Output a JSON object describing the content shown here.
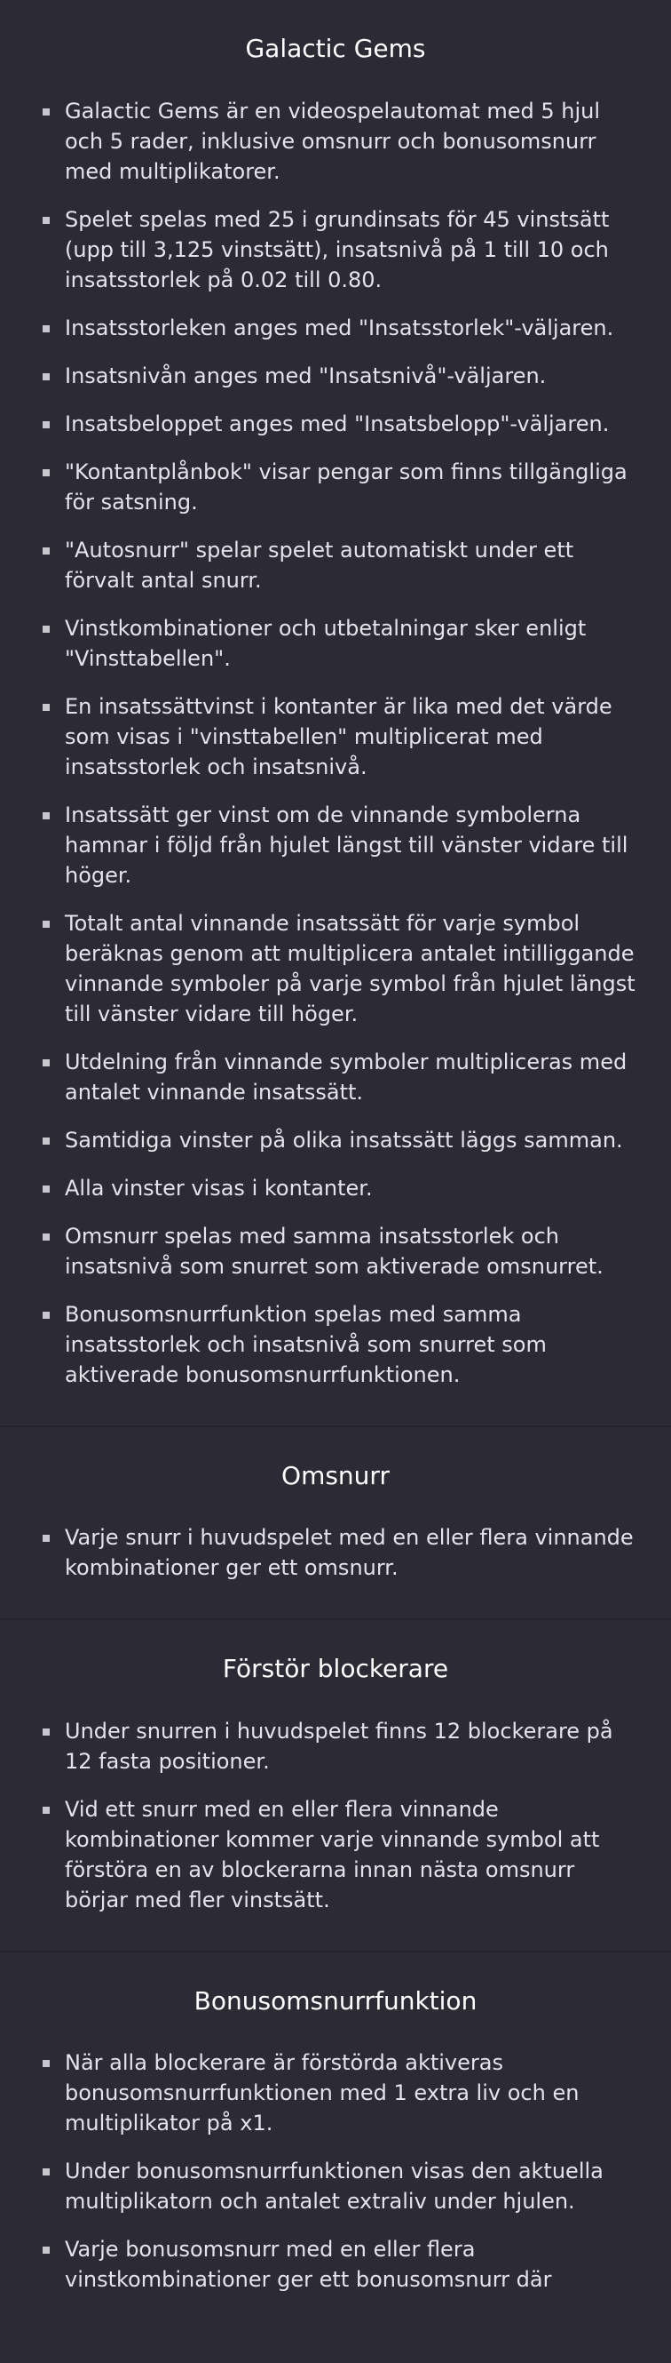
{
  "sections": [
    {
      "title": "Galactic Gems",
      "items": [
        "Galactic Gems är en videospelautomat med 5 hjul och 5 rader, inklusive omsnurr och bonusomsnurr med multiplikatorer.",
        "Spelet spelas med 25 i grundinsats för 45 vinstsätt (upp till 3,125 vinstsätt), insatsnivå på 1 till 10 och insatsstorlek på 0.02 till 0.80.",
        "Insatsstorleken anges med \"Insatsstorlek\"-väljaren.",
        "Insatsnivån anges med \"Insatsnivå\"-väljaren.",
        "Insatsbeloppet anges med \"Insatsbelopp\"-väljaren.",
        "\"Kontantplånbok\" visar pengar som finns tillgängliga för satsning.",
        "\"Autosnurr\" spelar spelet automatiskt under ett förvalt antal snurr.",
        "Vinstkombinationer och utbetalningar sker enligt \"Vinsttabellen\".",
        "En insatssättvinst i kontanter är lika med det värde som visas i \"vinsttabellen\" multiplicerat med insatsstorlek och insatsnivå.",
        "Insatssätt ger vinst om de vinnande symbolerna hamnar i följd från hjulet längst till vänster vidare till höger.",
        "Totalt antal vinnande insatssätt för varje symbol beräknas genom att multiplicera antalet intilliggande vinnande symboler på varje symbol från hjulet längst till vänster vidare till höger.",
        "Utdelning från vinnande symboler multipliceras med antalet vinnande insatssätt.",
        "Samtidiga vinster på olika insatssätt läggs samman.",
        "Alla vinster visas i kontanter.",
        "Omsnurr spelas med samma insatsstorlek och insatsnivå som snurret som aktiverade omsnurret.",
        "Bonusomsnurrfunktion spelas med samma insatsstorlek och insatsnivå som snurret som aktiverade bonusomsnurrfunktionen."
      ]
    },
    {
      "title": "Omsnurr",
      "items": [
        "Varje snurr i huvudspelet med en eller flera vinnande kombinationer ger ett omsnurr."
      ]
    },
    {
      "title": "Förstör blockerare",
      "items": [
        "Under snurren i huvudspelet finns 12 blockerare på 12 fasta positioner.",
        "Vid ett snurr med en eller flera vinnande kombinationer kommer varje vinnande symbol att förstöra en av blockerarna innan nästa omsnurr börjar med fler vinstsätt."
      ]
    },
    {
      "title": "Bonusomsnurrfunktion",
      "items": [
        "När alla blockerare är förstörda aktiveras bonusomsnurrfunktionen med 1 extra liv och en multiplikator på x1.",
        "Under bonusomsnurrfunktionen visas den aktuella multiplikatorn och antalet extraliv under hjulen.",
        "Varje bonusomsnurr med en eller flera vinstkombinationer ger ett bonusomsnurr där"
      ]
    }
  ]
}
